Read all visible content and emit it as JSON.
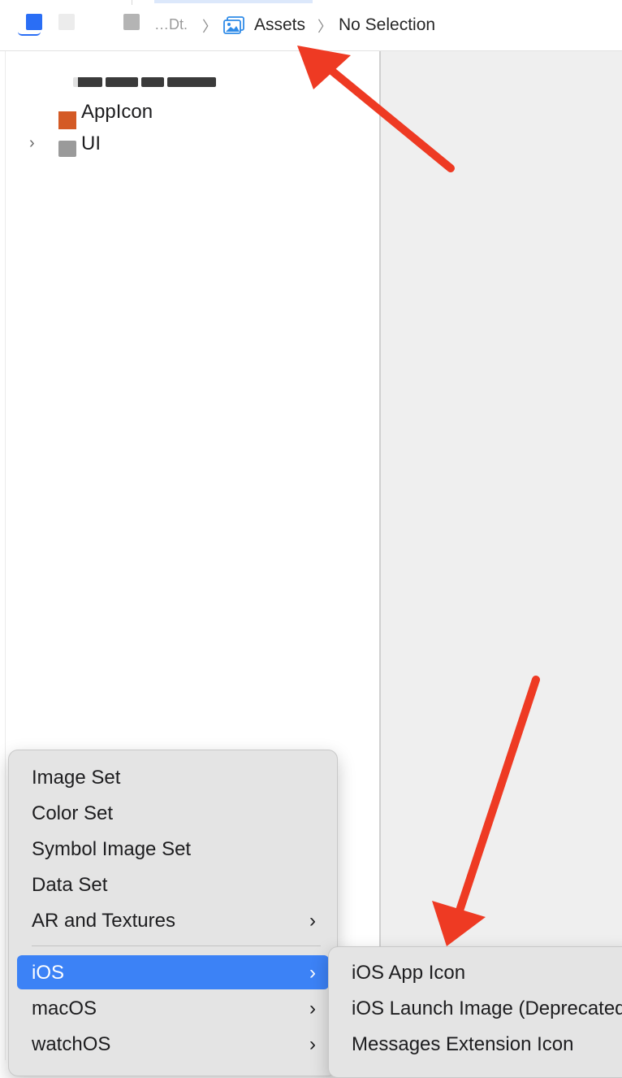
{
  "jumpbar": {
    "crumb_truncated": "…Dt.",
    "assets_label": "Assets",
    "selection_label": "No Selection",
    "separator": "〉"
  },
  "navigator": {
    "items": [
      {
        "label": "AppIcon",
        "icon": "appicon-icon"
      },
      {
        "label": "UI",
        "icon": "folder-icon",
        "chevron": "›"
      }
    ]
  },
  "context_menu": {
    "items": [
      {
        "label": "Image Set"
      },
      {
        "label": "Color Set"
      },
      {
        "label": "Symbol Image Set"
      },
      {
        "label": "Data Set"
      },
      {
        "label": "AR and Textures",
        "arrow": "›"
      },
      {
        "label": "iOS",
        "arrow": "›",
        "highlighted": true
      },
      {
        "label": "macOS",
        "arrow": "›"
      },
      {
        "label": "watchOS",
        "arrow": "›"
      }
    ]
  },
  "submenu": {
    "items": [
      {
        "label": "iOS App Icon"
      },
      {
        "label": "iOS Launch Image (Deprecated)"
      },
      {
        "label": "Messages Extension Icon"
      }
    ]
  },
  "colors": {
    "accent": "#3c82f6",
    "annotation_arrow": "#ee3a23",
    "appicon_swatch": "#d45a25"
  }
}
